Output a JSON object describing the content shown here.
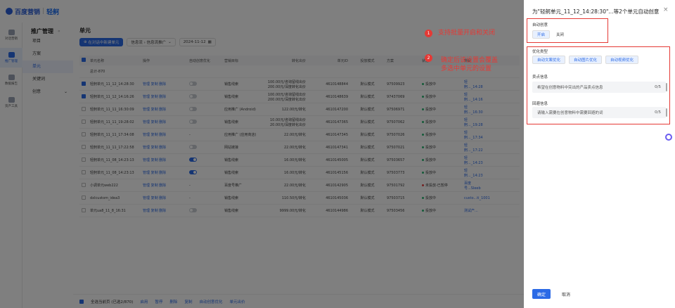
{
  "topbar": {
    "brand": "百度营销",
    "tool": "轻舸"
  },
  "rail": [
    {
      "label": "对话营销",
      "active": false
    },
    {
      "label": "推广管理",
      "active": true
    },
    {
      "label": "数据报告",
      "active": false
    },
    {
      "label": "资产工具",
      "active": false
    }
  ],
  "nav": {
    "title": "推广管理",
    "items": [
      {
        "label": "项目",
        "active": false
      },
      {
        "label": "方案",
        "active": false
      },
      {
        "label": "单元",
        "active": true
      },
      {
        "label": "关键词",
        "active": false
      },
      {
        "label": "创意",
        "active": false
      }
    ]
  },
  "main": {
    "title": "单元",
    "new_button": "在对话中新建单元",
    "filter_label": "信息流 › 信息流推广",
    "date": "2024-11-12"
  },
  "table": {
    "headers": [
      "单元名称",
      "操作",
      "自动创意优化",
      "营销目标",
      "转化出价",
      "单元ID",
      "投放模式",
      "方案",
      "状态",
      "所属"
    ],
    "total_row": "总计-870",
    "rows": [
      {
        "checked": true,
        "name": "轻舸单元_11_12_14:28:30",
        "ops": "管理 复制 删除",
        "toggle": "off",
        "goal": "销售线索",
        "bid": "100.00元/咨询留线出价 200.00元/深度转化出价",
        "id": "4610148844",
        "mode": "默认模式",
        "plan": "97509923",
        "status": "投放中",
        "status_color": "green",
        "own": "轻舸..._14:28"
      },
      {
        "checked": true,
        "name": "轻舸单元_11_12_14:16:26",
        "ops": "管理 复制 删除",
        "toggle": "off",
        "goal": "销售线索",
        "bid": "100.00元/咨询留线出价 200.00元/深度转化出价",
        "id": "4610148639",
        "mode": "默认模式",
        "plan": "97437069",
        "status": "投放中",
        "status_color": "green",
        "own": "轻舸..._14:16"
      },
      {
        "checked": false,
        "name": "轻舸单元_11_11_16:30:09",
        "ops": "管理 复制 删除",
        "toggle": "off",
        "goal": "应用推广 (Android)",
        "bid": "122.00元/转化",
        "id": "4610147200",
        "mode": "默认模式",
        "plan": "97506971",
        "status": "投放中",
        "status_color": "green",
        "own": "轻舸..._16:30"
      },
      {
        "checked": false,
        "name": "轻舸单元_11_11_19:28:02",
        "ops": "管理 复制 删除",
        "toggle": "off",
        "goal": "销售线索",
        "bid": "10.00元/咨询留线出价 20.00元/深度转化出价",
        "id": "4610147365",
        "mode": "默认模式",
        "plan": "97507062",
        "status": "投放中",
        "status_color": "green",
        "own": "轻舸..._19:28"
      },
      {
        "checked": false,
        "name": "轻舸单元_11_11_17:34:08",
        "ops": "管理 复制 删除",
        "toggle": "dash",
        "goal": "应用推广 (应用商店)",
        "bid": "22.00元/转化",
        "id": "4610147345",
        "mode": "默认模式",
        "plan": "97507026",
        "status": "投放中",
        "status_color": "green",
        "own": "轻舸..._17:34"
      },
      {
        "checked": false,
        "name": "轻舸单元_11_11_17:22:58",
        "ops": "管理 复制 删除",
        "toggle": "off",
        "goal": "网站链接",
        "bid": "22.00元/转化",
        "id": "4610147341",
        "mode": "默认模式",
        "plan": "97507021",
        "status": "投放中",
        "status_color": "green",
        "own": "轻舸..._17:22"
      },
      {
        "checked": false,
        "name": "轻舸单元_11_08_14:23:13",
        "ops": "管理 复制 删除",
        "toggle": "on",
        "goal": "销售线索",
        "bid": "16.00元/转化",
        "id": "4610145005",
        "mode": "默认模式",
        "plan": "97503657",
        "status": "投放中",
        "status_color": "green",
        "own": "轻舸..._14:23"
      },
      {
        "checked": false,
        "name": "轻舸单元_11_08_14:23:13",
        "ops": "管理 复制 删除",
        "toggle": "on",
        "goal": "销售线索",
        "bid": "16.00元/转化",
        "id": "4610145156",
        "mode": "默认模式",
        "plan": "97503773",
        "status": "投放中",
        "status_color": "green",
        "own": "轻舸..._14:23"
      },
      {
        "checked": false,
        "name": "小调单元web222",
        "ops": "管理 复制 删除",
        "toggle": "dash",
        "goal": "百度号推广",
        "bid": "22.00元/转化",
        "id": "4610142905",
        "mode": "默认模式",
        "plan": "97501792",
        "status": "未投放-已暂停",
        "status_color": "red",
        "own": "百度号...Sleeb"
      },
      {
        "checked": false,
        "name": "dxlcustom_idea3",
        "ops": "管理 复制 删除",
        "toggle": "dash",
        "goal": "销售线索",
        "bid": "110.50元/转化",
        "id": "4610145036",
        "mode": "默认模式",
        "plan": "97503715",
        "status": "投放中",
        "status_color": "green",
        "own": "custo...ti_1001"
      },
      {
        "checked": false,
        "name": "单元ua8_11_8_16:31",
        "ops": "管理 复制 删除",
        "toggle": "off",
        "goal": "销售线索",
        "bid": "9999.00元/转化",
        "id": "4610144986",
        "mode": "默认模式",
        "plan": "97503456",
        "status": "投放中",
        "status_color": "green",
        "own": "测试产..."
      }
    ]
  },
  "bottombar": {
    "select_all": "全选当前页 (已选2/870)",
    "actions": [
      "启用",
      "暂停",
      "删除",
      "复制",
      "自动创意优化",
      "单元出价"
    ]
  },
  "drawer": {
    "title": "为\"轻舸单元_11_12_14:28:30\"...等2个单元自动创意",
    "auto_label": "自动创意",
    "auto_options": [
      {
        "label": "开启",
        "selected": true
      },
      {
        "label": "关闭",
        "selected": false
      }
    ],
    "opt_label": "优化类型",
    "opt_options": [
      "自动文案优化",
      "自动图片优化",
      "自动视频优化"
    ],
    "selling_label": "卖点信息",
    "selling_placeholder": "希望在创意物料中突出的产品卖点信息",
    "selling_count": "0/5",
    "avoid_label": "回避信息",
    "avoid_placeholder": "请输入需要在创意物料中需要回避的词",
    "avoid_count": "0/5",
    "ok": "确定",
    "cancel": "取消"
  },
  "annotations": [
    {
      "num": "1",
      "text": "支持批量开启和关闭"
    },
    {
      "num": "2",
      "text": "确定后该设置会覆盖\n多选中单元的设置"
    }
  ],
  "colors": {
    "accent": "#2b6ae6",
    "annotation": "#e53935"
  }
}
